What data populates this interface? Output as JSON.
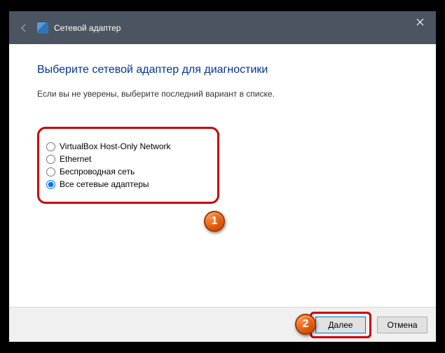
{
  "titlebar": {
    "title": "Сетевой адаптер"
  },
  "content": {
    "heading": "Выберите сетевой адаптер для диагностики",
    "subtext": "Если вы не уверены, выберите последний вариант в списке."
  },
  "options": [
    {
      "label": "VirtualBox Host-Only Network",
      "selected": false
    },
    {
      "label": "Ethernet",
      "selected": false
    },
    {
      "label": "Беспроводная сеть",
      "selected": false
    },
    {
      "label": "Все сетевые адаптеры",
      "selected": true
    }
  ],
  "markers": {
    "one": "1",
    "two": "2"
  },
  "footer": {
    "next": "Далее",
    "cancel": "Отмена"
  }
}
